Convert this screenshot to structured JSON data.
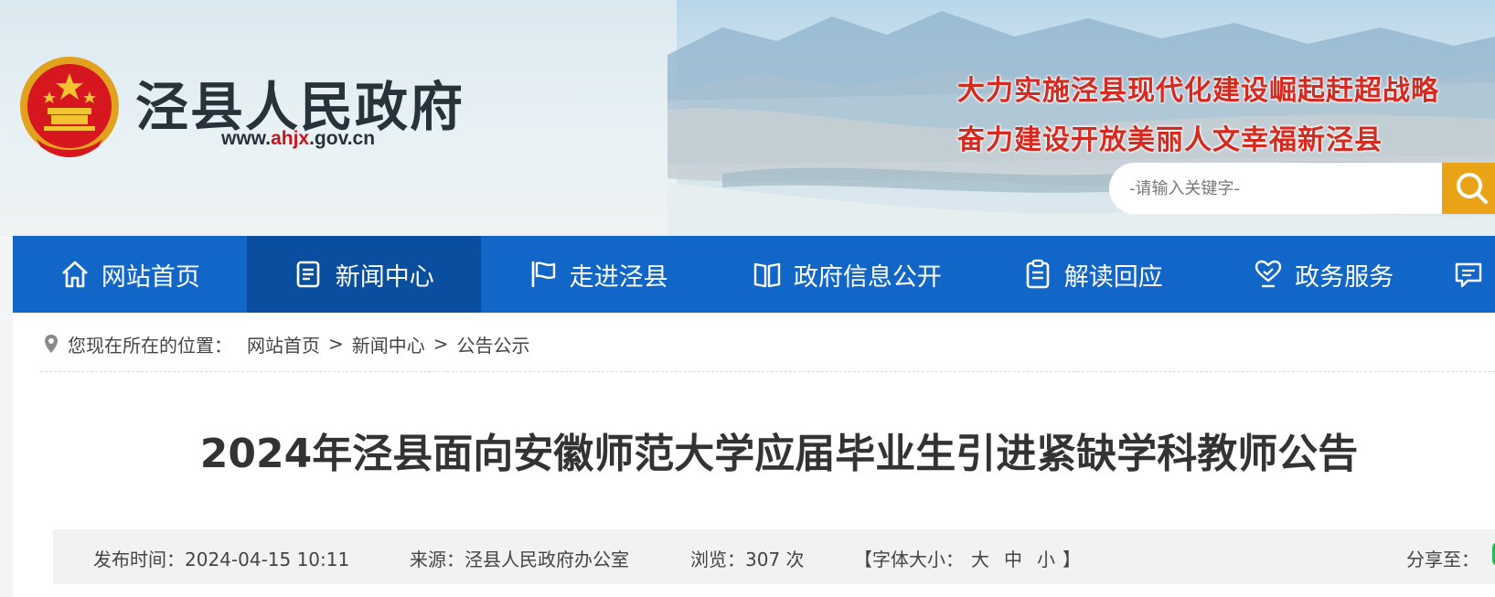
{
  "header": {
    "site_name": "泾县人民政府",
    "url_prefix": "www.",
    "url_highlight": "ahjx",
    "url_suffix": ".gov.cn",
    "slogan_line1": "大力实施泾县现代化建设崛起赶超战略",
    "slogan_line2": "奋力建设开放美丽人文幸福新泾县",
    "search": {
      "placeholder": "-请输入关键字-",
      "button_icon": "search-icon"
    }
  },
  "nav": {
    "items": [
      {
        "label": "网站首页",
        "icon": "home-icon"
      },
      {
        "label": "新闻中心",
        "icon": "news-icon",
        "active": true
      },
      {
        "label": "走进泾县",
        "icon": "flag-icon"
      },
      {
        "label": "政府信息公开",
        "icon": "book-icon"
      },
      {
        "label": "解读回应",
        "icon": "clipboard-icon"
      },
      {
        "label": "政务服务",
        "icon": "heart-service-icon"
      },
      {
        "label": "",
        "icon": "chat-icon"
      }
    ]
  },
  "breadcrumb": {
    "prefix": "您现在所在的位置：",
    "items": [
      "网站首页",
      "新闻中心",
      "公告公示"
    ],
    "separator": ">"
  },
  "article": {
    "title": "2024年泾县面向安徽师范大学应届毕业生引进紧缺学科教师公告",
    "meta": {
      "date_label": "发布时间：2024-04-15 10:11",
      "source_label": "来源：泾县人民政府办公室",
      "views_label": "浏览：307 次",
      "font_prefix": "【字体大小：",
      "font_large": "大",
      "font_medium": "中",
      "font_small": "小",
      "font_suffix": "】",
      "share_label": "分享至："
    }
  },
  "colors": {
    "nav_bg": "#1266c7",
    "nav_active": "#0a4f9f",
    "slogan": "#d42a20",
    "search_button": "#e8a317",
    "url_highlight": "#c8161d"
  }
}
